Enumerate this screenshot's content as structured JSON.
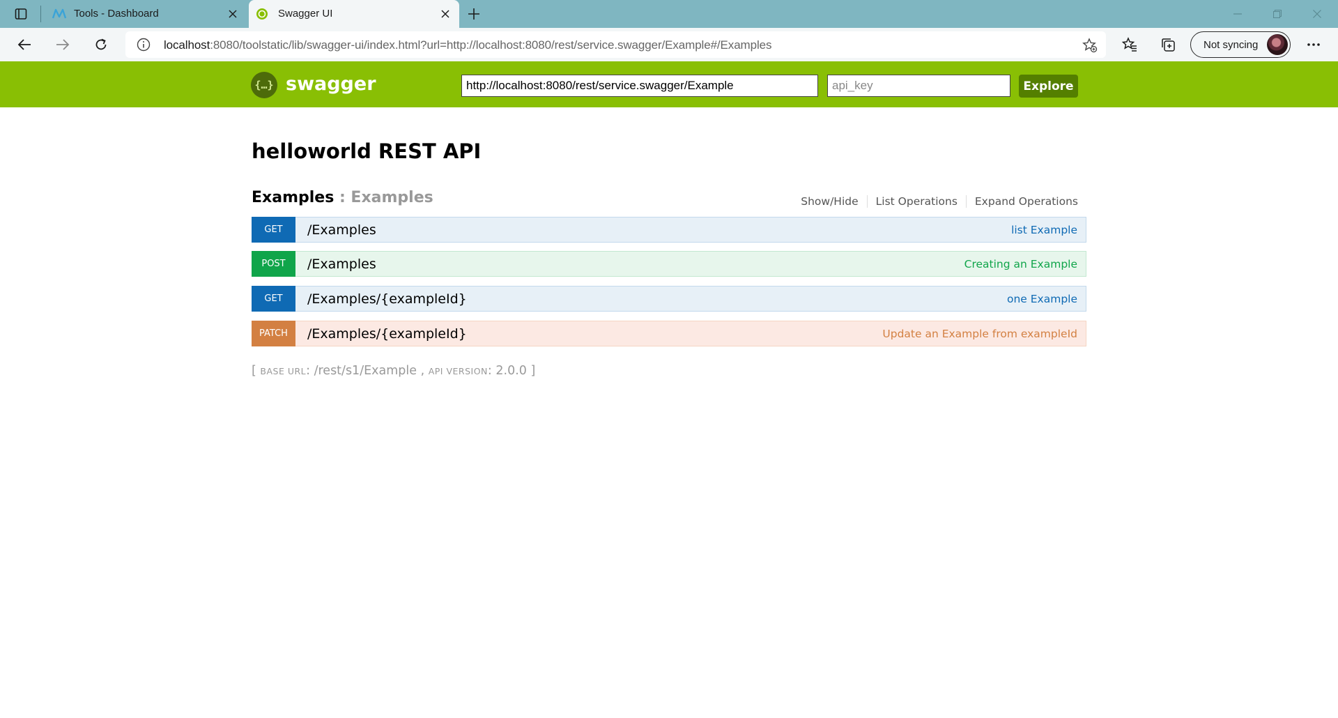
{
  "browser": {
    "tabs": [
      {
        "title": "Tools - Dashboard",
        "icon": "tools-logo-icon",
        "active": false
      },
      {
        "title": "Swagger UI",
        "icon": "swagger-favicon-icon",
        "active": true
      }
    ],
    "address": {
      "host": "localhost",
      "rest": ":8080/toolstatic/lib/swagger-ui/index.html?url=http://localhost:8080/rest/service.swagger/Example#/Examples"
    },
    "sync_label": "Not syncing"
  },
  "header": {
    "logo_mark": "{…}",
    "logo_text": "swagger",
    "spec_url": "http://localhost:8080/rest/service.swagger/Example",
    "api_key_placeholder": "api_key",
    "explore_label": "Explore",
    "brand_color": "#89bf04"
  },
  "api": {
    "title": "helloworld REST API",
    "resource": {
      "name": "Examples",
      "separator": " : ",
      "description": "Examples",
      "options": [
        "Show/Hide",
        "List Operations",
        "Expand Operations"
      ]
    },
    "operations": [
      {
        "method": "GET",
        "path": "/Examples",
        "summary": "list Example"
      },
      {
        "method": "POST",
        "path": "/Examples",
        "summary": "Creating an Example"
      },
      {
        "method": "GET",
        "path": "/Examples/{exampleId}",
        "summary": "one Example"
      },
      {
        "method": "PATCH",
        "path": "/Examples/{exampleId}",
        "summary": "Update an Example from exampleId"
      }
    ],
    "footer": {
      "open": "[ ",
      "base_url_label": "BASE URL",
      "base_url": "/rest/s1/Example",
      "mid": " , ",
      "version_label": "API VERSION",
      "version": "2.0.0",
      "close": " ]"
    }
  },
  "colors": {
    "get": "#0f6ab4",
    "post": "#10a54a",
    "patch": "#d38042"
  }
}
